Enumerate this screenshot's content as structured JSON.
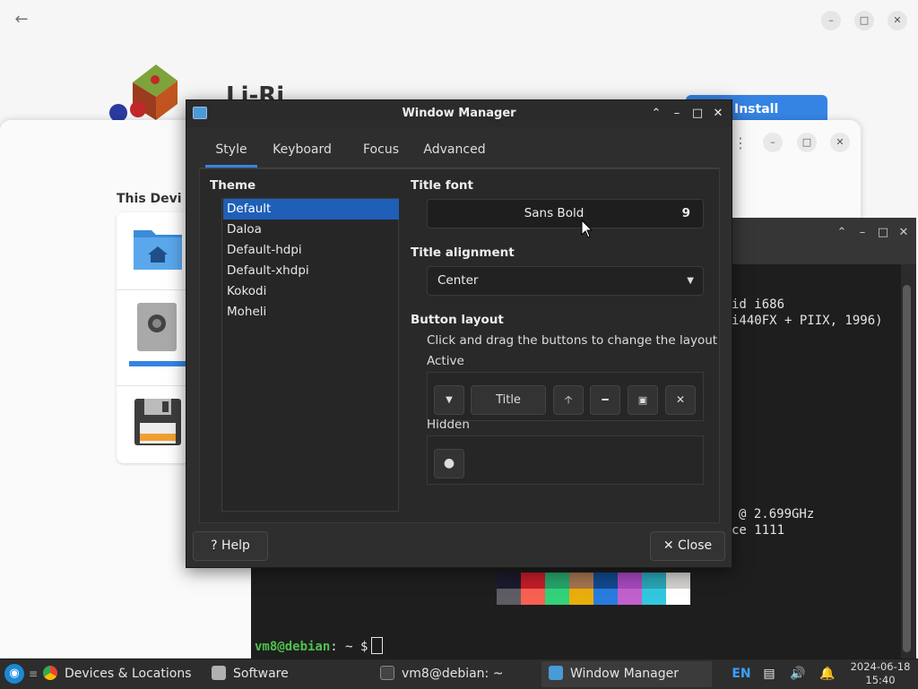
{
  "software": {
    "app_title": "Li-Ri",
    "install_label": "Install",
    "back_icon": "arrow-left-icon",
    "devices_dialog": {
      "heading": "This Devi"
    }
  },
  "terminal": {
    "lines": [
      "id i686",
      "i440FX + PIIX, 1996)",
      "@ 2.699GHz",
      "ce 1111"
    ],
    "prompt_user": "vm8@debian",
    "prompt_rest": ": ~ $",
    "palette_top": [
      "#1a1a2e",
      "#c01c28",
      "#26a269",
      "#a2734c",
      "#12488b",
      "#a347ba",
      "#2aa1b3",
      "#d0cfcc"
    ],
    "palette_bottom": [
      "#5e5c64",
      "#f66151",
      "#33d17a",
      "#e9ad0c",
      "#2a7bde",
      "#c061cb",
      "#33c7de",
      "#ffffff"
    ]
  },
  "wm": {
    "title": "Window Manager",
    "tabs": [
      "Style",
      "Keyboard",
      "Focus",
      "Advanced"
    ],
    "active_tab": "Style",
    "theme_heading": "Theme",
    "themes": [
      "Default",
      "Daloa",
      "Default-hdpi",
      "Default-xhdpi",
      "Kokodi",
      "Moheli"
    ],
    "selected_theme": "Default",
    "title_font_heading": "Title font",
    "title_font_name": "Sans Bold",
    "title_font_size": "9",
    "title_alignment_heading": "Title alignment",
    "title_alignment_value": "Center",
    "button_layout_heading": "Button layout",
    "button_layout_hint": "Click and drag the buttons to change the layout",
    "active_label": "Active",
    "hidden_label": "Hidden",
    "active_buttons": [
      "menu",
      "Title",
      "shade",
      "minimize",
      "maximize",
      "close"
    ],
    "title_button_label": "Title",
    "help_label": "Help",
    "close_label": "Close",
    "accent_color": "#3584e4",
    "selection_color": "#1f5fb8"
  },
  "taskbar": {
    "tasks": [
      {
        "label": "Devices & Locations",
        "icon": "chrome-icon"
      },
      {
        "label": "Software",
        "icon": "software-icon"
      },
      {
        "label": "vm8@debian: ~",
        "icon": "terminal-icon"
      },
      {
        "label": "Window Manager",
        "icon": "window-manager-icon"
      }
    ],
    "keyboard_layout": "EN",
    "date": "2024-06-18",
    "time": "15:40"
  }
}
